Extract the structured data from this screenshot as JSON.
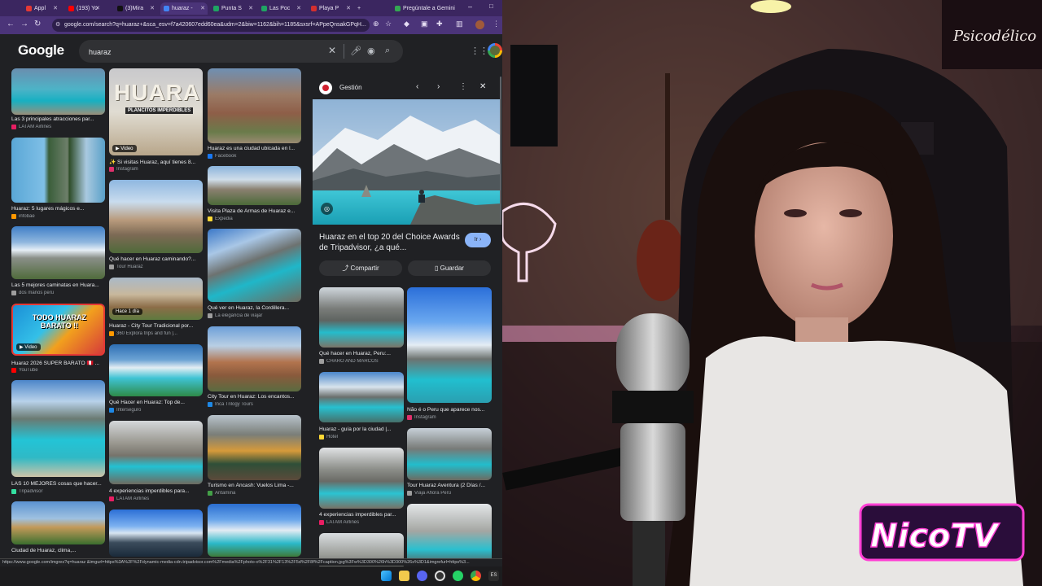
{
  "browser": {
    "tabs": [
      {
        "label": "Appl",
        "color": "#e53935"
      },
      {
        "label": "(193) Yo",
        "color": "#ff0000"
      },
      {
        "label": "(3)Mira",
        "color": "#111111"
      },
      {
        "label": "huaraz -",
        "color": "#4285f4"
      },
      {
        "label": "Punta S",
        "color": "#1fa463"
      },
      {
        "label": "Las Poc",
        "color": "#1fa463"
      },
      {
        "label": "Playa P",
        "color": "#d32f2f"
      },
      {
        "label": "Pregúntale a Gemini",
        "color": "#34a853"
      }
    ],
    "new_tab_label": "+",
    "url": "google.com/search?q=huaraz+&sca_esv=f7a420607edd60ea&udm=2&biw=1162&bih=1185&sxsrf=APpeQnsakGPqH..."
  },
  "google": {
    "logo": "Google",
    "query": "huaraz"
  },
  "results": [
    {
      "title": "Las 3 principales atracciones par...",
      "source": "LATAM Airlines",
      "src_color": "#e91e63"
    },
    {
      "title": "Huaraz: 5 lugares mágicos e...",
      "source": "infobae",
      "src_color": "#ff9800"
    },
    {
      "title": "Las 5 mejores caminatas en Huara...",
      "source": "dos manos peru",
      "src_color": "#9e9e9e"
    },
    {
      "title": "Huaraz 2026 SUPER BARATO 🇵🇪 ...",
      "source": "YouTube",
      "src_color": "#ff0000",
      "badge": "▶ Video",
      "overlay": "TODO HUARAZ BARATO !!"
    },
    {
      "title": "LAS 10 MEJORES cosas que hacer...",
      "source": "Tripadvisor",
      "src_color": "#34e0a1"
    },
    {
      "title": "Ciudad de Huaraz, clima,...",
      "source": "",
      "src_color": "#9e9e9e"
    },
    {
      "title": "✨ Si visitas Huaraz, aquí tienes 8...",
      "source": "Instagram",
      "src_color": "#e1306c",
      "badge": "▶ Video",
      "overlay": "HUARA",
      "overlay_sub": "PLANCITOS IMPERDIBLES"
    },
    {
      "title": "Qué hacer en Huaraz caminando?...",
      "source": "Tour Huaraz",
      "src_color": "#9e9e9e"
    },
    {
      "title": "Huaraz - City Tour Tradicional por...",
      "source": "360 Explora trips and fun |...",
      "src_color": "#ff9800",
      "badge": "Hace 1 día"
    },
    {
      "title": "Qué Hacer en Huaraz: Top de...",
      "source": "Interseguro",
      "src_color": "#1e88e5"
    },
    {
      "title": "4 experiencias imperdibles para...",
      "source": "LATAM Airlines",
      "src_color": "#e91e63"
    },
    {
      "title": "Huaraz es una ciudad ubicada en l...",
      "source": "Facebook",
      "src_color": "#1877f2"
    },
    {
      "title": "Visita Plaza de Armas de Huaraz e...",
      "source": "Expedia",
      "src_color": "#fdd835"
    },
    {
      "title": "Qué ver en Huaraz, la Cordillera...",
      "source": "La elegancia de viajar",
      "src_color": "#9e9e9e"
    },
    {
      "title": "City Tour en Huaraz: Los encantos...",
      "source": "Inca Trilogy Tours",
      "src_color": "#1e88e5"
    },
    {
      "title": "Turismo en Áncash: Vuelos Lima -...",
      "source": "Antamina",
      "src_color": "#43a047"
    }
  ],
  "panel": {
    "source": "Gestión",
    "title": "Huaraz en el top 20 del Choice Awards de Tripadvisor, ¿a qué...",
    "visit_label": "Ir ›",
    "share_label": "Compartir",
    "save_label": "Guardar",
    "related": [
      {
        "title": "Qué hacer en Huaraz, Peru:...",
        "source": "CHARO AND MARCOS",
        "src_color": "#9e9e9e"
      },
      {
        "title": "Huaraz - guía por la ciudad |...",
        "source": "Hotel",
        "src_color": "#fdd835"
      },
      {
        "title": "4 experiencias imperdibles par...",
        "source": "LATAM Airlines",
        "src_color": "#e91e63"
      },
      {
        "title": "Não é o Peru que aparece nos...",
        "source": "Instagram",
        "src_color": "#e1306c"
      },
      {
        "title": "Tour Huaraz Aventura (2 Días /...",
        "source": "Viaja Ahora Perú",
        "src_color": "#9e9e9e"
      }
    ]
  },
  "status_url": "https://www.google.com/imgres?q=huaraz &imgurl=https%3A%2F%2Fdynamic-media-cdn.tripadvisor.com%2Fmedia%2Fphoto-o%2F31%2F13%2F5d%2F8f%2Fcaption.jpg%3Fw%3D300%26h%3D300%26s%3D1&imgrefurl=https%3...",
  "webcam": {
    "neon_sign": "Psicodélico",
    "overlay_logo": "NicoTV"
  },
  "colors": {
    "browser_chrome": "#3b2660",
    "google_bg": "#202124",
    "accent_blue": "#8ab4f8",
    "neon_pink": "#ff3fd4"
  }
}
